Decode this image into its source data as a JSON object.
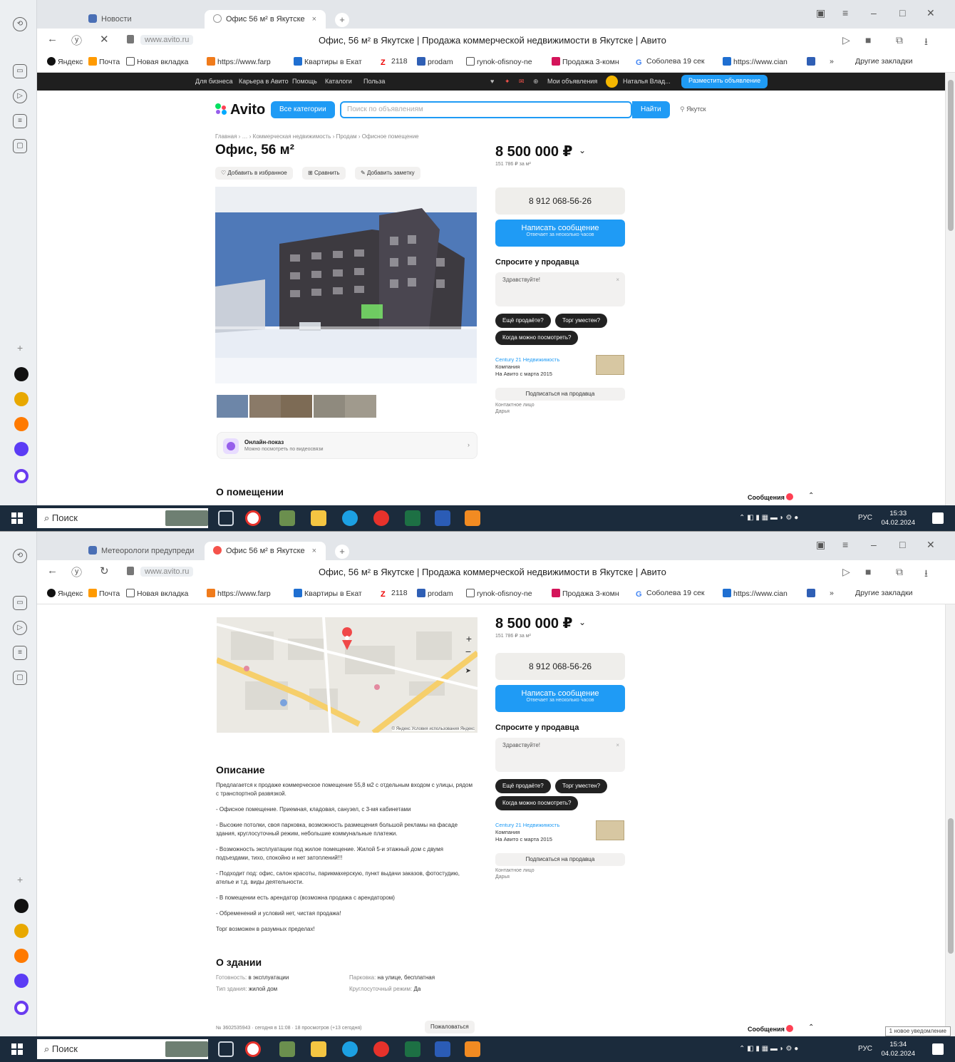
{
  "tabs": {
    "screen1_first": "Новости",
    "screen2_first": "Метеорологи предупреди",
    "active": "Офис 56 м² в Якутске",
    "close": "×",
    "new": "+"
  },
  "address": {
    "domain": "www.avito.ru",
    "page_title": "Офис, 56 м² в Якутске | Продажа коммерческой недвижимости в Якутске | Авито"
  },
  "bookmarks": {
    "items": [
      "Яндекс",
      "Почта",
      "Новая вкладка",
      "https://www.farp",
      "Квартиры в Екат",
      "2118",
      "prodam",
      "rynok-ofisnoy-ne",
      "Продажа 3-комн",
      "Соболева 19 сек",
      "https://www.cian"
    ],
    "more": "»",
    "other": "Другие закладки"
  },
  "avito_topbar": {
    "links": [
      "Для бизнеса",
      "Карьера в Авито",
      "Помощь",
      "Каталоги",
      "Польза"
    ],
    "my_ads": "Мои объявления",
    "user": "Наталья Влад...",
    "post_ad": "Разместить объявление"
  },
  "avito_header": {
    "logo": "Avito",
    "all_categories": "Все категории",
    "search_placeholder": "Поиск по объявлениям",
    "find": "Найти",
    "location": "Якутск"
  },
  "listing": {
    "breadcrumbs": "Главная › … › Коммерческая недвижимость › Продам › Офисное помещение",
    "title": "Офис, 56 м²",
    "actions": [
      "Добавить в избранное",
      "Сравнить",
      "Добавить заметку"
    ],
    "price": "8 500 000 ₽",
    "price_per_m2": "151 786 ₽ за м²",
    "phone": "8 912 068-56-26",
    "write_message": "Написать сообщение",
    "write_message_sub": "Отвечает за несколько часов",
    "ask_seller_heading": "Спросите у продавца",
    "ask_placeholder": "Здравствуйте!",
    "quick_questions": [
      "Ещё продаёте?",
      "Торг уместен?",
      "Когда можно посмотреть?"
    ],
    "seller_name": "Century 21 Недвижимость",
    "seller_type": "Компания",
    "seller_since": "На Авито с марта 2015",
    "subscribe": "Подписаться на продавца",
    "contact_person_label": "Контактное лицо",
    "contact_person": "Дарья",
    "online_tour": "Онлайн-показ",
    "online_tour_sub": "Можно посмотреть по видеосвязи",
    "about_premises": "О помещении",
    "messages": "Сообщения"
  },
  "description": {
    "heading": "Описание",
    "paragraphs": [
      "Предлагается к продаже коммерческое помещение 55,8 м2 с отдельным входом с улицы, рядом с транспортной развязкой.",
      "- Офисное помещение. Приемная, кладовая, санузел, с 3-мя кабинетами",
      "- Высокие потолки, своя парковка, возможность размещения большой рекламы на фасаде здания, круглосуточный режим, небольшие коммунальные платежи.",
      "- Возможность эксплуатации под жилое помещение. Жилой 5-и этажный дом с двумя подъездами, тихо, спокойно и нет затоплений!!!",
      "- Подходит под: офис, салон красоты, парикмахерскую, пункт выдачи заказов, фотостудию, ателье и т.д. виды деятельности.",
      "- В помещении есть арендатор (возможна продажа с арендатором)",
      "- Обременений и условий нет, чистая продажа!",
      "Торг возможен в разумных пределах!"
    ]
  },
  "building": {
    "heading": "О здании",
    "rows": [
      {
        "k": "Готовность:",
        "v": "в эксплуатации"
      },
      {
        "k": "Парковка:",
        "v": "на улице, бесплатная"
      },
      {
        "k": "Тип здания:",
        "v": "жилой дом"
      },
      {
        "k": "Круглосуточный режим:",
        "v": "Да"
      }
    ],
    "footer": "№ 3602535943 · сегодня в 11:08 · 18 просмотров (+13 сегодня)",
    "complain": "Пожаловаться"
  },
  "map": {
    "credits": "© Яндекс  Условия использования  Яндекс",
    "zoom_in": "+",
    "zoom_out": "−"
  },
  "taskbar": {
    "search": "Поиск",
    "lang": "РУС",
    "time1": "15:33",
    "time2": "15:34",
    "date": "04.02.2024"
  },
  "toast": "1 новое уведомление",
  "colors": {
    "accent": "#1f9bf5",
    "avito_dark": "#1f1f1f",
    "taskbar": "#1b2b3c"
  }
}
